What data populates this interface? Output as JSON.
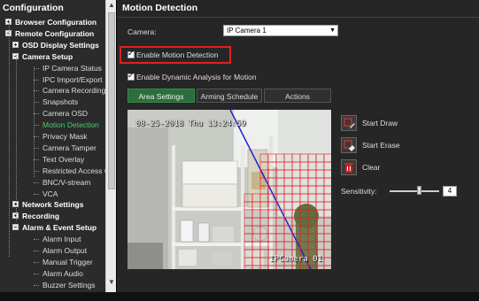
{
  "sidebar": {
    "title": "Configuration",
    "items": [
      {
        "label": "Browser Configuration",
        "level": 0,
        "expander": "plus",
        "bold": true
      },
      {
        "label": "Remote Configuration",
        "level": 0,
        "expander": "minus",
        "bold": true
      },
      {
        "label": "OSD Display Settings",
        "level": 1,
        "expander": "plus",
        "bold": true
      },
      {
        "label": "Camera Setup",
        "level": 1,
        "expander": "minus",
        "bold": true
      },
      {
        "label": "IP Camera Status",
        "level": 2
      },
      {
        "label": "IPC Import/Export",
        "level": 2
      },
      {
        "label": "Camera Recording S",
        "level": 2
      },
      {
        "label": "Snapshots",
        "level": 2
      },
      {
        "label": "Camera OSD",
        "level": 2
      },
      {
        "label": "Motion Detection",
        "level": 2,
        "active": true
      },
      {
        "label": "Privacy Mask",
        "level": 2
      },
      {
        "label": "Camera Tamper",
        "level": 2
      },
      {
        "label": "Text Overlay",
        "level": 2
      },
      {
        "label": "Restricted Access C",
        "level": 2
      },
      {
        "label": "BNC/V-stream",
        "level": 2
      },
      {
        "label": "VCA",
        "level": 2
      },
      {
        "label": "Network Settings",
        "level": 1,
        "expander": "plus",
        "bold": true
      },
      {
        "label": "Recording",
        "level": 1,
        "expander": "plus",
        "bold": true
      },
      {
        "label": "Alarm & Event Setup",
        "level": 1,
        "expander": "minus",
        "bold": true
      },
      {
        "label": "Alarm Input",
        "level": 2
      },
      {
        "label": "Alarm Output",
        "level": 2
      },
      {
        "label": "Manual Trigger",
        "level": 2
      },
      {
        "label": "Alarm Audio",
        "level": 2
      },
      {
        "label": "Buzzer Settings",
        "level": 2
      }
    ],
    "scroll_up_icon": "▲",
    "scroll_down_icon": "▼"
  },
  "main": {
    "title": "Motion Detection",
    "camera_label": "Camera:",
    "camera_value": "IP Camera 1",
    "dropdown_arrow": "▼",
    "enable_motion_label": "Enable Motion Detection",
    "enable_dynamic_label": "Enable Dynamic Analysis for Motion",
    "tabs": [
      {
        "label": "Area Settings",
        "active": true
      },
      {
        "label": "Arming Schedule"
      },
      {
        "label": "Actions"
      }
    ],
    "video": {
      "osd_datetime": "08-25-2018 Thu 13:24:59",
      "osd_camera": "IPCamera 01"
    },
    "actions": {
      "start_draw": "Start Draw",
      "start_erase": "Start Erase",
      "clear": "Clear"
    },
    "sensitivity_label": "Sensitivity:",
    "sensitivity_value": "4",
    "sensitivity_level_fraction": 0.6
  },
  "colors": {
    "active_item": "#3fd16b",
    "highlight": "#e02020",
    "tab_active": "#2b6e3c",
    "grid": "#e02020"
  }
}
